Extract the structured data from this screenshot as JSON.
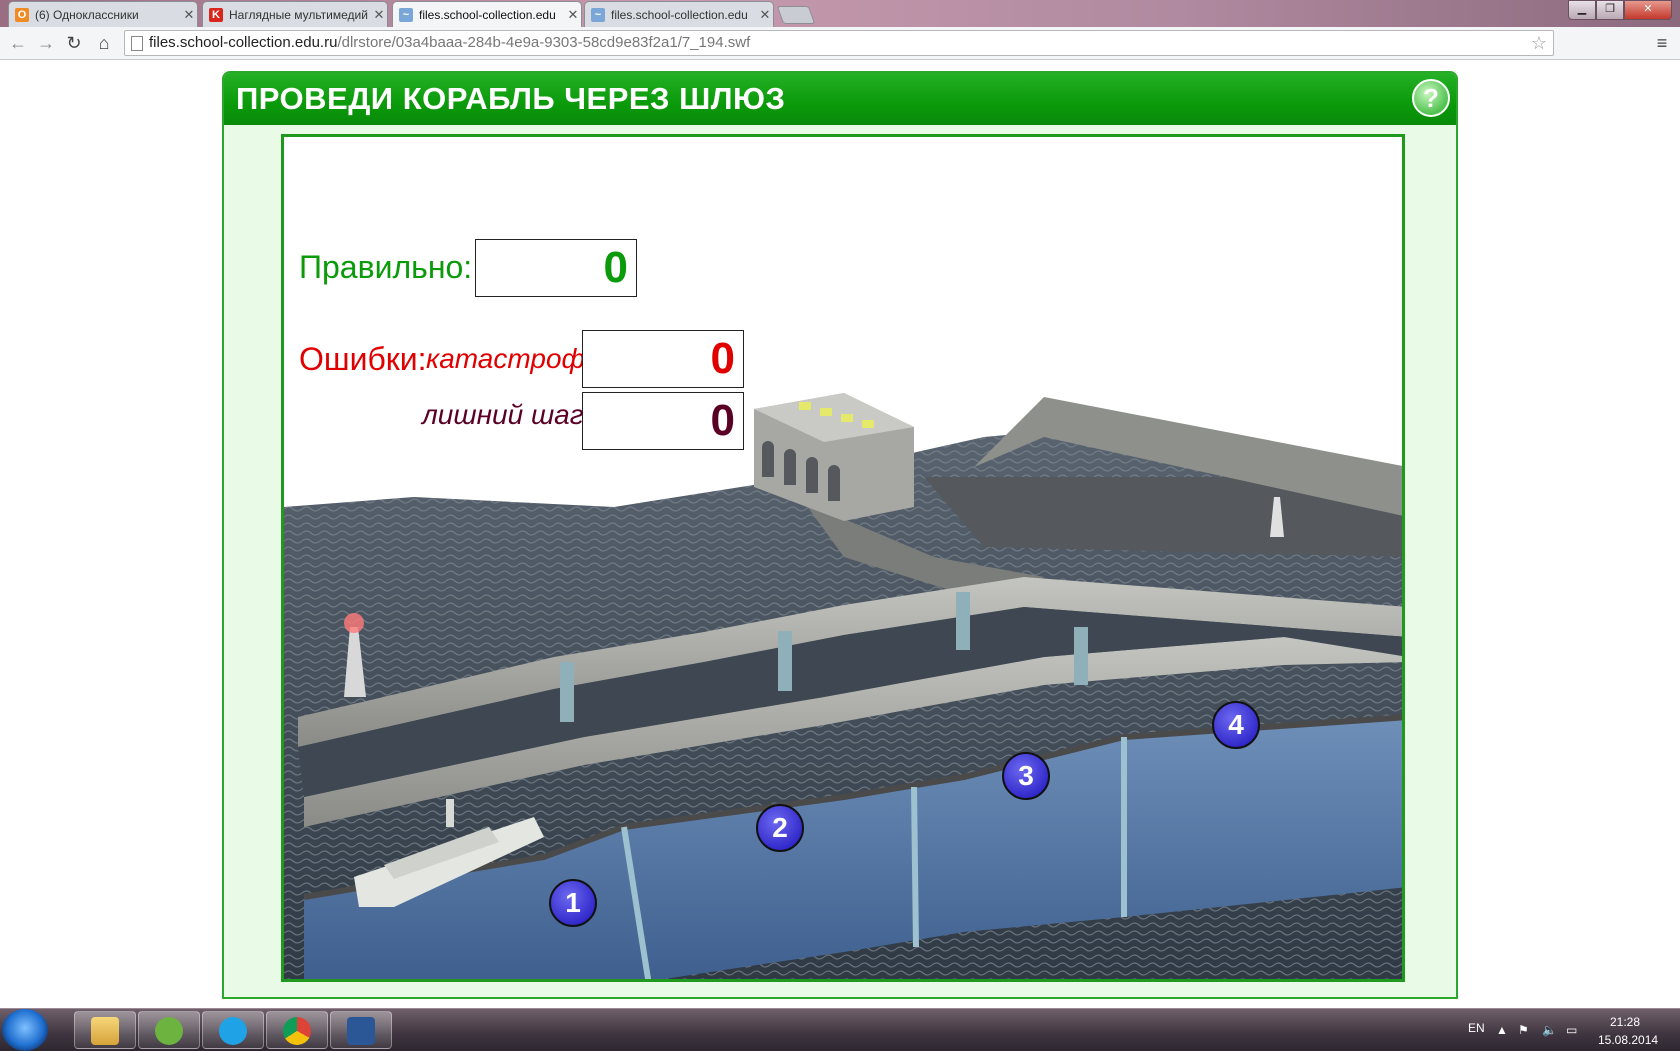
{
  "browser": {
    "tabs": [
      {
        "title": "(6) Одноклассники",
        "favicon": "odnoklassniki-icon",
        "active": false
      },
      {
        "title": "Наглядные мультимедий",
        "favicon": "k-site-icon",
        "active": false
      },
      {
        "title": "files.school-collection.edu",
        "favicon": "swf-file-icon",
        "active": true
      },
      {
        "title": "files.school-collection.edu",
        "favicon": "swf-file-icon",
        "active": false
      }
    ],
    "url_host": "files.school-collection.edu.ru",
    "url_path": "/dlrstore/03a4baaa-284b-4e9a-9303-58cd9e83f2a1/7_194.swf"
  },
  "app": {
    "title": "ПРОВЕДИ КОРАБЛЬ ЧЕРЕЗ ШЛЮЗ",
    "help_label": "?",
    "correct_label": "Правильно:",
    "correct_value": "0",
    "errors_label": "Ошибки:",
    "catastrophe_label": "катастрофа",
    "catastrophe_value": "0",
    "extra_step_label": "лишний шаг",
    "extra_step_value": "0",
    "steps": [
      "1",
      "2",
      "3",
      "4"
    ],
    "colors": {
      "header_green": "#0a9a0a",
      "correct_green": "#0a9a0a",
      "error_red": "#e00000",
      "extra_maroon": "#5a0025",
      "step_blue": "#3a33d6"
    }
  },
  "taskbar": {
    "pinned": [
      "explorer-icon",
      "utorrent-icon",
      "skype-icon",
      "chrome-icon",
      "word-icon"
    ],
    "language": "EN",
    "time": "21:28",
    "date": "15.08.2014"
  }
}
